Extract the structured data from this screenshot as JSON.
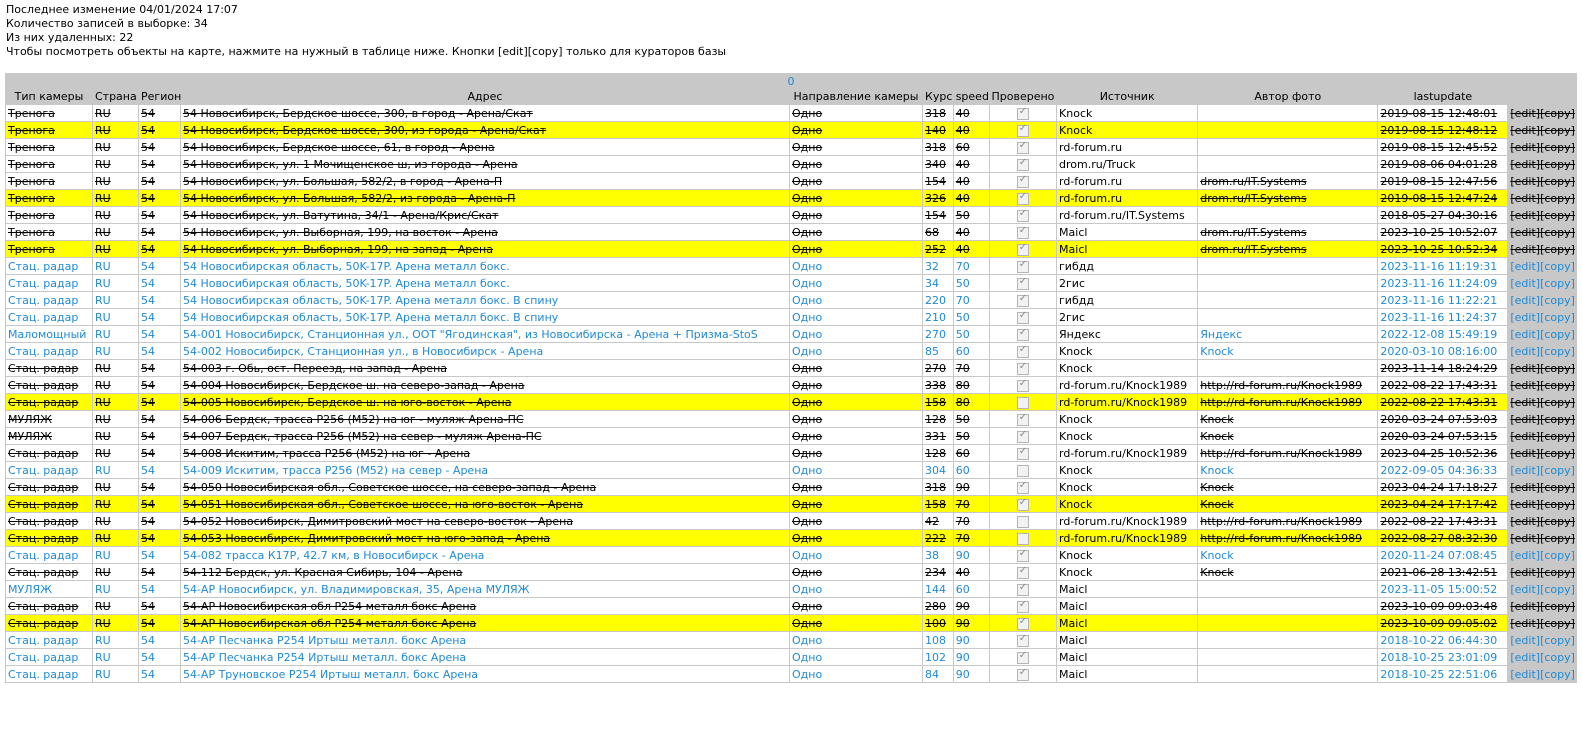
{
  "info": {
    "last_change": "Последнее изменение 04/01/2024 17:07",
    "count": "Количество записей в выборке: 34",
    "deleted": "Из них удаленных: 22",
    "hint": "Чтобы посмотреть объекты на карте, нажмите на нужный в таблице ниже. Кнопки [edit][copy] только для кураторов базы"
  },
  "table": {
    "count_label": "0",
    "headers": [
      "Тип камеры",
      "Страна",
      "Регион",
      "Адрес",
      "Направление камеры",
      "Курс",
      "speed",
      "Проверено",
      "Источник",
      "Автор фото",
      "lastupdate",
      ""
    ],
    "edit_label": "[edit]",
    "copy_label": "[copy]",
    "rows": [
      {
        "type": "Тренога",
        "country": "RU",
        "region": "54",
        "address": "54 Новосибирск, Бердское шоссе, 300, в город - Арена/Скат",
        "dir": "Одно",
        "course": "318",
        "speed": "40",
        "checked": true,
        "source": "Knock",
        "author": "",
        "lastupdate": "2019-08-15 12:48:01",
        "deleted": true,
        "hl": false
      },
      {
        "type": "Тренога",
        "country": "RU",
        "region": "54",
        "address": "54 Новосибирск, Бердское шоссе, 300, из города - Арена/Скат",
        "dir": "Одно",
        "course": "140",
        "speed": "40",
        "checked": true,
        "source": "Knock",
        "author": "",
        "lastupdate": "2019-08-15 12:48:12",
        "deleted": true,
        "hl": true
      },
      {
        "type": "Тренога",
        "country": "RU",
        "region": "54",
        "address": "54 Новосибирск, Бердское шоссе, 61, в город - Арена",
        "dir": "Одно",
        "course": "318",
        "speed": "60",
        "checked": true,
        "source": "rd-forum.ru",
        "author": "",
        "lastupdate": "2019-08-15 12:45:52",
        "deleted": true,
        "hl": false
      },
      {
        "type": "Тренога",
        "country": "RU",
        "region": "54",
        "address": "54 Новосибирск, ул. 1 Мочищенское ш, из города - Арена",
        "dir": "Одно",
        "course": "340",
        "speed": "40",
        "checked": true,
        "source": "drom.ru/Truck",
        "author": "",
        "lastupdate": "2019-08-06 04:01:28",
        "deleted": true,
        "hl": false
      },
      {
        "type": "Тренога",
        "country": "RU",
        "region": "54",
        "address": "54 Новосибирск, ул. Большая, 582/2, в город - Арена-П",
        "dir": "Одно",
        "course": "154",
        "speed": "40",
        "checked": true,
        "source": "rd-forum.ru",
        "author": "drom.ru/IT.Systems",
        "lastupdate": "2019-08-15 12:47:56",
        "deleted": true,
        "hl": false
      },
      {
        "type": "Тренога",
        "country": "RU",
        "region": "54",
        "address": "54 Новосибирск, ул. Большая, 582/2, из города - Арена-П",
        "dir": "Одно",
        "course": "326",
        "speed": "40",
        "checked": true,
        "source": "rd-forum.ru",
        "author": "drom.ru/IT.Systems",
        "lastupdate": "2019-08-15 12:47:24",
        "deleted": true,
        "hl": true
      },
      {
        "type": "Тренога",
        "country": "RU",
        "region": "54",
        "address": "54 Новосибирск, ул. Ватутина, 34/1 - Арена/Крис/Скат",
        "dir": "Одно",
        "course": "154",
        "speed": "50",
        "checked": true,
        "source": "rd-forum.ru/IT.Systems",
        "author": "",
        "lastupdate": "2018-05-27 04:30:16",
        "deleted": true,
        "hl": false
      },
      {
        "type": "Тренога",
        "country": "RU",
        "region": "54",
        "address": "54 Новосибирск, ул. Выборная, 199, на восток - Арена",
        "dir": "Одно",
        "course": "68",
        "speed": "40",
        "checked": true,
        "source": "Maicl",
        "author": "drom.ru/IT.Systems",
        "lastupdate": "2023-10-25 10:52:07",
        "deleted": true,
        "hl": false
      },
      {
        "type": "Тренога",
        "country": "RU",
        "region": "54",
        "address": "54 Новосибирск, ул. Выборная, 199, на запад - Арена",
        "dir": "Одно",
        "course": "252",
        "speed": "40",
        "checked": true,
        "source": "Maicl",
        "author": "drom.ru/IT.Systems",
        "lastupdate": "2023-10-25 10:52:34",
        "deleted": true,
        "hl": true
      },
      {
        "type": "Стац. радар",
        "country": "RU",
        "region": "54",
        "address": "54 Новосибирская область, 50K-17P. Арена металл бокс.",
        "dir": "Одно",
        "course": "32",
        "speed": "70",
        "checked": true,
        "source": "гибдд",
        "author": "",
        "lastupdate": "2023-11-16 11:19:31",
        "deleted": false,
        "hl": false
      },
      {
        "type": "Стац. радар",
        "country": "RU",
        "region": "54",
        "address": "54 Новосибирская область, 50K-17P. Арена металл бокс.",
        "dir": "Одно",
        "course": "34",
        "speed": "50",
        "checked": true,
        "source": "2гис",
        "author": "",
        "lastupdate": "2023-11-16 11:24:09",
        "deleted": false,
        "hl": false
      },
      {
        "type": "Стац. радар",
        "country": "RU",
        "region": "54",
        "address": "54 Новосибирская область, 50K-17P. Арена металл бокс. В спину",
        "dir": "Одно",
        "course": "220",
        "speed": "70",
        "checked": true,
        "source": "гибдд",
        "author": "",
        "lastupdate": "2023-11-16 11:22:21",
        "deleted": false,
        "hl": false
      },
      {
        "type": "Стац. радар",
        "country": "RU",
        "region": "54",
        "address": "54 Новосибирская область, 50K-17P. Арена металл бокс. В спину",
        "dir": "Одно",
        "course": "210",
        "speed": "50",
        "checked": true,
        "source": "2гис",
        "author": "",
        "lastupdate": "2023-11-16 11:24:37",
        "deleted": false,
        "hl": false
      },
      {
        "type": "Маломощный",
        "country": "RU",
        "region": "54",
        "address": "54-001 Новосибирск, Станционная ул., ООТ \"Ягодинская\", из Новосибирска - Арена + Призма-StoS",
        "dir": "Одно",
        "course": "270",
        "speed": "50",
        "checked": true,
        "source": "Яндекс",
        "author": "Яндекс",
        "lastupdate": "2022-12-08 15:49:19",
        "deleted": false,
        "hl": false
      },
      {
        "type": "Стац. радар",
        "country": "RU",
        "region": "54",
        "address": "54-002 Новосибирск, Станционная ул., в Новосибирск - Арена",
        "dir": "Одно",
        "course": "85",
        "speed": "60",
        "checked": true,
        "source": "Knock",
        "author": "Knock",
        "lastupdate": "2020-03-10 08:16:00",
        "deleted": false,
        "hl": false
      },
      {
        "type": "Стац. радар",
        "country": "RU",
        "region": "54",
        "address": "54-003 г. Обь, ост. Переезд, на запад - Арена",
        "dir": "Одно",
        "course": "270",
        "speed": "70",
        "checked": true,
        "source": "Knock",
        "author": "",
        "lastupdate": "2023-11-14 18:24:29",
        "deleted": true,
        "hl": false
      },
      {
        "type": "Стац. радар",
        "country": "RU",
        "region": "54",
        "address": "54-004 Новосибирск, Бердское ш. на северо-запад - Арена",
        "dir": "Одно",
        "course": "338",
        "speed": "80",
        "checked": true,
        "source": "rd-forum.ru/Knock1989",
        "author": "http://rd-forum.ru/Knock1989",
        "lastupdate": "2022-08-22 17:43:31",
        "deleted": true,
        "hl": false
      },
      {
        "type": "Стац. радар",
        "country": "RU",
        "region": "54",
        "address": "54-005 Новосибирск, Бердское ш. на юго-восток - Арена",
        "dir": "Одно",
        "course": "158",
        "speed": "80",
        "checked": false,
        "source": "rd-forum.ru/Knock1989",
        "author": "http://rd-forum.ru/Knock1989",
        "lastupdate": "2022-08-22 17:43:31",
        "deleted": true,
        "hl": true
      },
      {
        "type": "МУЛЯЖ",
        "country": "RU",
        "region": "54",
        "address": "54-006 Бердск, трасса Р256 (М52) на юг - муляж Арена-ПС",
        "dir": "Одно",
        "course": "128",
        "speed": "50",
        "checked": true,
        "source": "Knock",
        "author": "Knock",
        "lastupdate": "2020-03-24 07:53:03",
        "deleted": true,
        "hl": false
      },
      {
        "type": "МУЛЯЖ",
        "country": "RU",
        "region": "54",
        "address": "54-007 Бердск, трасса Р256 (М52) на север - муляж Арена-ПС",
        "dir": "Одно",
        "course": "331",
        "speed": "50",
        "checked": true,
        "source": "Knock",
        "author": "Knock",
        "lastupdate": "2020-03-24 07:53:15",
        "deleted": true,
        "hl": false
      },
      {
        "type": "Стац. радар",
        "country": "RU",
        "region": "54",
        "address": "54-008 Искитим, трасса Р256 (М52) на юг - Арена",
        "dir": "Одно",
        "course": "128",
        "speed": "60",
        "checked": true,
        "source": "rd-forum.ru/Knock1989",
        "author": "http://rd-forum.ru/Knock1989",
        "lastupdate": "2023-04-25 10:52:36",
        "deleted": true,
        "hl": false
      },
      {
        "type": "Стац. радар",
        "country": "RU",
        "region": "54",
        "address": "54-009 Искитим, трасса Р256 (М52) на север - Арена",
        "dir": "Одно",
        "course": "304",
        "speed": "60",
        "checked": false,
        "source": "Knock",
        "author": "Knock",
        "lastupdate": "2022-09-05 04:36:33",
        "deleted": false,
        "hl": false
      },
      {
        "type": "Стац. радар",
        "country": "RU",
        "region": "54",
        "address": "54-050 Новосибирская обл., Советское шоссе, на северо-запад - Арена",
        "dir": "Одно",
        "course": "318",
        "speed": "90",
        "checked": true,
        "source": "Knock",
        "author": "Knock",
        "lastupdate": "2023-04-24 17:18:27",
        "deleted": true,
        "hl": false
      },
      {
        "type": "Стац. радар",
        "country": "RU",
        "region": "54",
        "address": "54-051 Новосибирская обл., Советское шоссе, на юго-восток - Арена",
        "dir": "Одно",
        "course": "158",
        "speed": "70",
        "checked": true,
        "source": "Knock",
        "author": "Knock",
        "lastupdate": "2023-04-24 17:17:42",
        "deleted": true,
        "hl": true
      },
      {
        "type": "Стац. радар",
        "country": "RU",
        "region": "54",
        "address": "54-052 Новосибирск, Димитровский мост на северо-восток - Арена",
        "dir": "Одно",
        "course": "42",
        "speed": "70",
        "checked": false,
        "source": "rd-forum.ru/Knock1989",
        "author": "http://rd-forum.ru/Knock1989",
        "lastupdate": "2022-08-22 17:43:31",
        "deleted": true,
        "hl": false
      },
      {
        "type": "Стац. радар",
        "country": "RU",
        "region": "54",
        "address": "54-053 Новосибирск, Димитровский мост на юго-запад - Арена",
        "dir": "Одно",
        "course": "222",
        "speed": "70",
        "checked": false,
        "source": "rd-forum.ru/Knock1989",
        "author": "http://rd-forum.ru/Knock1989",
        "lastupdate": "2022-08-27 08:32:30",
        "deleted": true,
        "hl": true
      },
      {
        "type": "Стац. радар",
        "country": "RU",
        "region": "54",
        "address": "54-082 трасса К17Р, 42.7 км, в Новосибирск - Арена",
        "dir": "Одно",
        "course": "38",
        "speed": "90",
        "checked": true,
        "source": "Knock",
        "author": "Knock",
        "lastupdate": "2020-11-24 07:08:45",
        "deleted": false,
        "hl": false
      },
      {
        "type": "Стац. радар",
        "country": "RU",
        "region": "54",
        "address": "54-112 Бердск, ул. Красная Сибирь, 104 - Арена",
        "dir": "Одно",
        "course": "234",
        "speed": "40",
        "checked": true,
        "source": "Knock",
        "author": "Knock",
        "lastupdate": "2021-06-28 13:42:51",
        "deleted": true,
        "hl": false
      },
      {
        "type": "МУЛЯЖ",
        "country": "RU",
        "region": "54",
        "address": "54-АР Новосибирск, ул. Владимировская, 35, Арена МУЛЯЖ",
        "dir": "Одно",
        "course": "144",
        "speed": "60",
        "checked": true,
        "source": "Maicl",
        "author": "",
        "lastupdate": "2023-11-05 15:00:52",
        "deleted": false,
        "hl": false
      },
      {
        "type": "Стац. радар",
        "country": "RU",
        "region": "54",
        "address": "54-АР Новосибирская обл Р254 металл бокс Арена",
        "dir": "Одно",
        "course": "280",
        "speed": "90",
        "checked": true,
        "source": "Maicl",
        "author": "",
        "lastupdate": "2023-10-09 09:03:48",
        "deleted": true,
        "hl": false
      },
      {
        "type": "Стац. радар",
        "country": "RU",
        "region": "54",
        "address": "54-АР Новосибирская обл Р254 металл бокс Арена",
        "dir": "Одно",
        "course": "100",
        "speed": "90",
        "checked": true,
        "source": "Maicl",
        "author": "",
        "lastupdate": "2023-10-09 09:05:02",
        "deleted": true,
        "hl": true
      },
      {
        "type": "Стац. радар",
        "country": "RU",
        "region": "54",
        "address": "54-АР Песчанка Р254 Иртыш металл. бокс Арена",
        "dir": "Одно",
        "course": "108",
        "speed": "90",
        "checked": true,
        "source": "Maicl",
        "author": "",
        "lastupdate": "2018-10-22 06:44:30",
        "deleted": false,
        "hl": false
      },
      {
        "type": "Стац. радар",
        "country": "RU",
        "region": "54",
        "address": "54-АР Песчанка Р254 Иртыш металл. бокс Арена",
        "dir": "Одно",
        "course": "102",
        "speed": "90",
        "checked": true,
        "source": "Maicl",
        "author": "",
        "lastupdate": "2018-10-25 23:01:09",
        "deleted": false,
        "hl": false
      },
      {
        "type": "Стац. радар",
        "country": "RU",
        "region": "54",
        "address": "54-АР Труновское Р254 Иртыш металл. бокс Арена",
        "dir": "Одно",
        "course": "84",
        "speed": "90",
        "checked": true,
        "source": "Maicl",
        "author": "",
        "lastupdate": "2018-10-25 22:51:06",
        "deleted": false,
        "hl": false
      }
    ]
  }
}
